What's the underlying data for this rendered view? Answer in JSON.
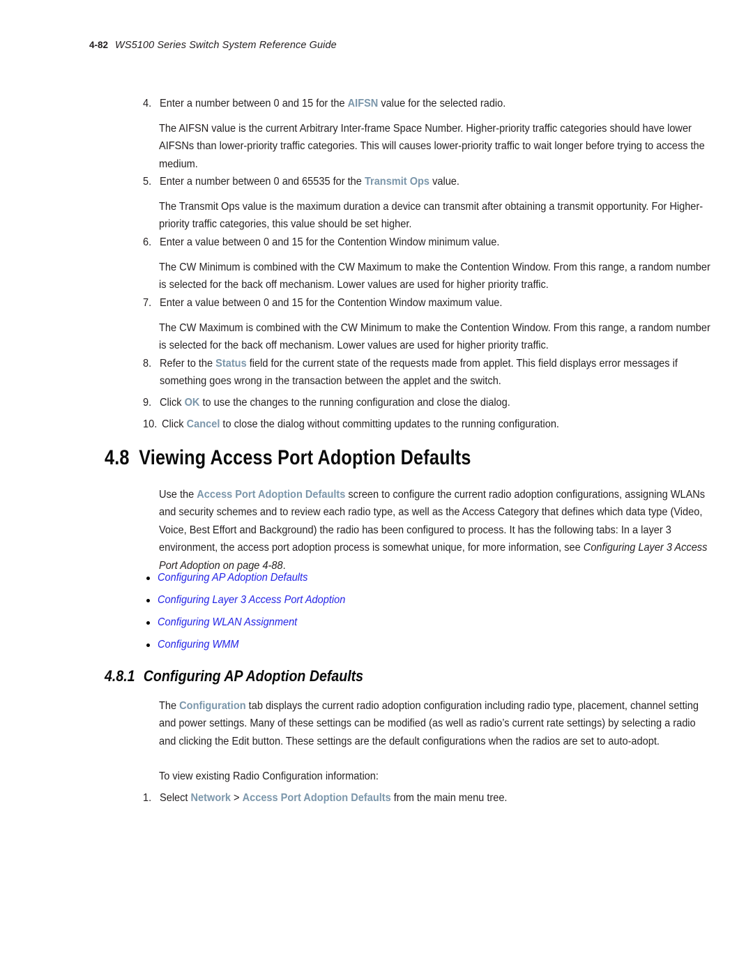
{
  "page": {
    "folio": "4-82",
    "running_header": "WS5100 Series Switch System Reference Guide"
  },
  "colors": {
    "emphasis": "#7c97ab",
    "link": "#2323e6",
    "text": "#231f20"
  },
  "steps": [
    {
      "marker": "4.",
      "text_pre": "Enter a number between 0 and 15 for the ",
      "emphasis": "AIFSN",
      "text_post": " value for the selected radio."
    },
    {
      "marker": "5.",
      "text_pre": "Enter a number between 0 and 65535 for the ",
      "emphasis": "Transmit Ops",
      "text_post": " value."
    },
    {
      "marker": "6.",
      "text_pre": "Enter a value between 0 and 15 for the Contention Window minimum value.",
      "emphasis": "",
      "text_post": ""
    },
    {
      "marker": "7.",
      "text_pre": "Enter a value between 0 and 15 for the Contention Window maximum value.",
      "emphasis": "",
      "text_post": ""
    },
    {
      "marker": "8.",
      "text_pre": "Refer to the ",
      "emphasis": "Status",
      "text_post": " field for the current state of the requests made from applet. This field displays error messages if something goes wrong in the transaction between the applet and the switch."
    },
    {
      "marker": "9.",
      "text_pre": "Click ",
      "emphasis": "OK",
      "text_post": " to use the changes to the running configuration and close the dialog."
    },
    {
      "marker": "10.",
      "text_pre": "Click ",
      "emphasis": "Cancel",
      "text_post": " to close the dialog without committing updates to the running configuration."
    }
  ],
  "paragraphs": {
    "aifsn_desc": "The AIFSN value is the current Arbitrary Inter-frame Space Number. Higher-priority traffic categories should have lower AIFSNs than lower-priority traffic categories. This will causes lower-priority traffic to wait longer before trying to access the medium.",
    "txops_desc": "The Transmit Ops value is the maximum duration a device can transmit after obtaining a transmit opportunity. For Higher-priority traffic categories, this value should be set higher.",
    "cwmin_desc": "The CW Minimum is combined with the CW Maximum to make the Contention Window. From this range, a random number is selected for the back off mechanism. Lower values are used for higher priority traffic.",
    "cwmax_desc": "The CW Maximum is combined with the CW Minimum to make the Contention Window. From this range, a random number is selected for the back off mechanism. Lower values are used for higher priority traffic."
  },
  "section_48": {
    "number": "4.8",
    "title": "Viewing Access Port Adoption Defaults",
    "intro_pre": "Use the ",
    "intro_emphasis": "Access Port Adoption Defaults",
    "intro_mid": " screen to configure the current radio adoption configurations, assigning WLANs and security schemes and to review each radio type, as well as the Access Category that defines which data type (Video, Voice, Best Effort and Background) the radio has been configured to process. It has the following tabs: In a layer 3 environment, the access port adoption process is somewhat unique, for more information, see ",
    "intro_italic": "Configuring Layer 3 Access Port Adoption on page 4-88",
    "intro_post": ".",
    "crossrefs": [
      "Configuring AP Adoption Defaults",
      "Configuring Layer 3 Access Port Adoption",
      "Configuring WLAN Assignment",
      "Configuring WMM"
    ]
  },
  "section_481": {
    "number": "4.8.1",
    "title": "Configuring AP Adoption Defaults",
    "body_pre": "The ",
    "body_emphasis": "Configuration",
    "body_post": " tab displays the current radio adoption configuration including radio type, placement, channel setting and power settings. Many of these settings can be modified (as well as radio’s current rate settings) by selecting a radio and clicking the Edit button. These settings are the default configurations when the radios are set to auto-adopt.",
    "lead_in": "To view existing Radio Configuration information:",
    "step": {
      "marker": "1.",
      "text_pre": "Select ",
      "emphasis_a": "Network",
      "separator": " > ",
      "emphasis_b": "Access Port Adoption Defaults",
      "text_post": " from the main menu tree."
    }
  }
}
